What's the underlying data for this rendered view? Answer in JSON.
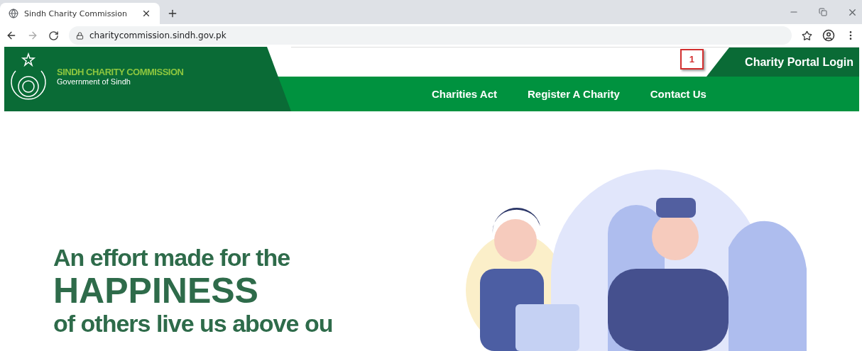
{
  "browser": {
    "tab_title": "Sindh Charity Commission",
    "url": "charitycommission.sindh.gov.pk"
  },
  "site_header": {
    "title": "SINDH CHARITY COMMISSION",
    "subtitle": "Government of Sindh",
    "portal_login": "Charity Portal Login",
    "annotation": "1"
  },
  "nav": [
    {
      "label": "Charities Act"
    },
    {
      "label": "Register A Charity"
    },
    {
      "label": "Contact Us"
    }
  ],
  "hero": {
    "lines": [
      {
        "text": "An effort made for the",
        "kind": "small"
      },
      {
        "text": "HAPPINESS",
        "kind": "large"
      },
      {
        "text": "of others live us above ou",
        "kind": "small"
      }
    ]
  }
}
